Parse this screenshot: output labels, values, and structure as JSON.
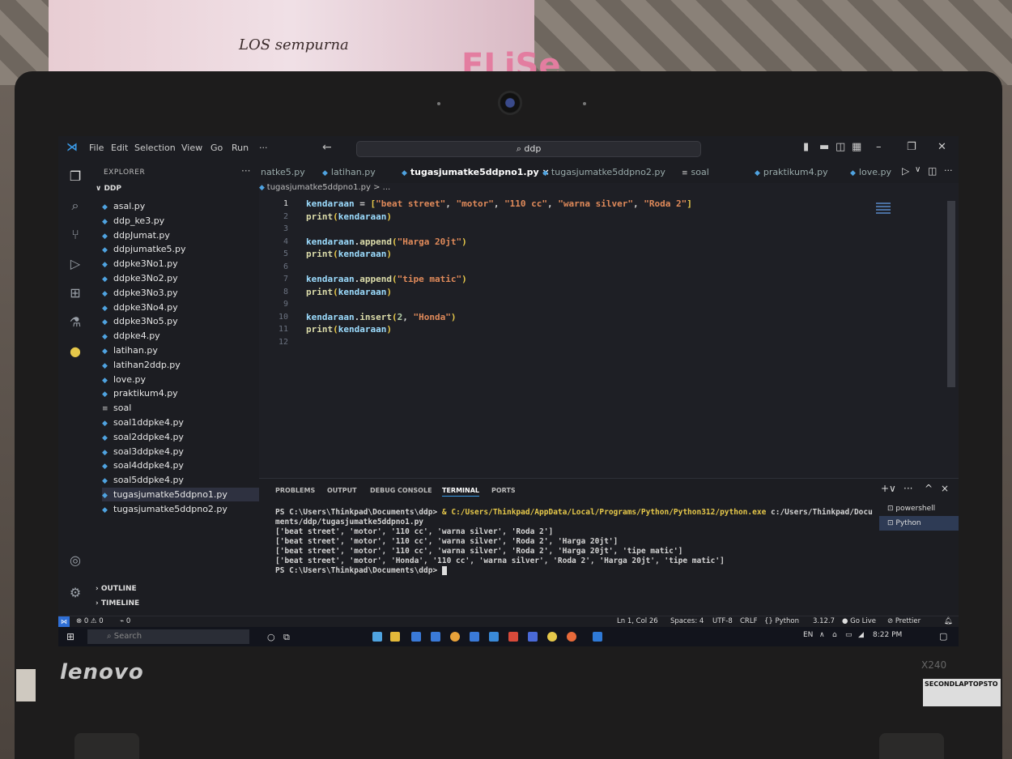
{
  "window": {
    "menu": [
      "File",
      "Edit",
      "Selection",
      "View",
      "Go",
      "Run",
      "···"
    ],
    "search_text": "ddp"
  },
  "explorer": {
    "title": "EXPLORER",
    "more": "···",
    "root": "DDP",
    "files": [
      {
        "name": "asal.py",
        "type": "py"
      },
      {
        "name": "ddp_ke3.py",
        "type": "py"
      },
      {
        "name": "ddpJumat.py",
        "type": "py"
      },
      {
        "name": "ddpjumatke5.py",
        "type": "py"
      },
      {
        "name": "ddpke3No1.py",
        "type": "py"
      },
      {
        "name": "ddpke3No2.py",
        "type": "py"
      },
      {
        "name": "ddpke3No3.py",
        "type": "py"
      },
      {
        "name": "ddpke3No4.py",
        "type": "py"
      },
      {
        "name": "ddpke3No5.py",
        "type": "py"
      },
      {
        "name": "ddpke4.py",
        "type": "py"
      },
      {
        "name": "latihan.py",
        "type": "py"
      },
      {
        "name": "latihan2ddp.py",
        "type": "py"
      },
      {
        "name": "love.py",
        "type": "py"
      },
      {
        "name": "praktikum4.py",
        "type": "py"
      },
      {
        "name": "soal",
        "type": "txt"
      },
      {
        "name": "soal1ddpke4.py",
        "type": "py"
      },
      {
        "name": "soal2ddpke4.py",
        "type": "py"
      },
      {
        "name": "soal3ddpke4.py",
        "type": "py"
      },
      {
        "name": "soal4ddpke4.py",
        "type": "py"
      },
      {
        "name": "soal5ddpke4.py",
        "type": "py"
      },
      {
        "name": "tugasjumatke5ddpno1.py",
        "type": "py",
        "selected": true
      },
      {
        "name": "tugasjumatke5ddpno2.py",
        "type": "py"
      }
    ],
    "outline": "OUTLINE",
    "timeline": "TIMELINE"
  },
  "tabs": [
    {
      "label": "natke5.py"
    },
    {
      "label": "latihan.py"
    },
    {
      "label": "tugasjumatke5ddpno1.py",
      "active": true,
      "close": "×"
    },
    {
      "label": "tugasjumatke5ddpno2.py"
    },
    {
      "label": "soal"
    },
    {
      "label": "praktikum4.py"
    },
    {
      "label": "love.py"
    }
  ],
  "breadcrumb": "tugasjumatke5ddpno1.py > ...",
  "editor": {
    "line_numbers": [
      "1",
      "2",
      "3",
      "4",
      "5",
      "6",
      "7",
      "8",
      "9",
      "10",
      "11",
      "12"
    ],
    "lines": [
      [
        {
          "t": "kendaraan",
          "c": "v"
        },
        {
          "t": " = ",
          "c": "o"
        },
        {
          "t": "[",
          "c": "p"
        },
        {
          "t": "\"beat street\"",
          "c": "s"
        },
        {
          "t": ", ",
          "c": "o"
        },
        {
          "t": "\"motor\"",
          "c": "s"
        },
        {
          "t": ", ",
          "c": "o"
        },
        {
          "t": "\"110 cc\"",
          "c": "s"
        },
        {
          "t": ", ",
          "c": "o"
        },
        {
          "t": "\"warna silver\"",
          "c": "s"
        },
        {
          "t": ", ",
          "c": "o"
        },
        {
          "t": "\"Roda 2\"",
          "c": "s"
        },
        {
          "t": "]",
          "c": "p"
        }
      ],
      [
        {
          "t": "print",
          "c": "f"
        },
        {
          "t": "(",
          "c": "p"
        },
        {
          "t": "kendaraan",
          "c": "v"
        },
        {
          "t": ")",
          "c": "p"
        }
      ],
      [],
      [
        {
          "t": "kendaraan",
          "c": "v"
        },
        {
          "t": ".",
          "c": "o"
        },
        {
          "t": "append",
          "c": "f"
        },
        {
          "t": "(",
          "c": "p"
        },
        {
          "t": "\"Harga 20jt\"",
          "c": "s"
        },
        {
          "t": ")",
          "c": "p"
        }
      ],
      [
        {
          "t": "print",
          "c": "f"
        },
        {
          "t": "(",
          "c": "p"
        },
        {
          "t": "kendaraan",
          "c": "v"
        },
        {
          "t": ")",
          "c": "p"
        }
      ],
      [],
      [
        {
          "t": "kendaraan",
          "c": "v"
        },
        {
          "t": ".",
          "c": "o"
        },
        {
          "t": "append",
          "c": "f"
        },
        {
          "t": "(",
          "c": "p"
        },
        {
          "t": "\"tipe matic\"",
          "c": "s"
        },
        {
          "t": ")",
          "c": "p"
        }
      ],
      [
        {
          "t": "print",
          "c": "f"
        },
        {
          "t": "(",
          "c": "p"
        },
        {
          "t": "kendaraan",
          "c": "v"
        },
        {
          "t": ")",
          "c": "p"
        }
      ],
      [],
      [
        {
          "t": "kendaraan",
          "c": "v"
        },
        {
          "t": ".",
          "c": "o"
        },
        {
          "t": "insert",
          "c": "f"
        },
        {
          "t": "(",
          "c": "p"
        },
        {
          "t": "2",
          "c": "n"
        },
        {
          "t": ", ",
          "c": "o"
        },
        {
          "t": "\"Honda\"",
          "c": "s"
        },
        {
          "t": ")",
          "c": "p"
        }
      ],
      [
        {
          "t": "print",
          "c": "f"
        },
        {
          "t": "(",
          "c": "p"
        },
        {
          "t": "kendaraan",
          "c": "v"
        },
        {
          "t": ")",
          "c": "p"
        }
      ],
      []
    ]
  },
  "panel": {
    "tabs": [
      "PROBLEMS",
      "OUTPUT",
      "DEBUG CONSOLE",
      "TERMINAL",
      "PORTS"
    ],
    "active_tab": "TERMINAL",
    "controls": [
      "+∨",
      "···",
      "^",
      "×"
    ],
    "terminal": {
      "cmd_prompt": "PS C:\\Users\\Thinkpad\\Documents\\ddp> ",
      "cmd_amp": "& ",
      "cmd_exe": "C:/Users/Thinkpad/AppData/Local/Programs/Python/Python312/python.exe",
      "cmd_arg": " c:/Users/Thinkpad/Docu",
      "cmd_wrap": "ments/ddp/tugasjumatke5ddpno1.py",
      "output": [
        "['beat street', 'motor', '110 cc', 'warna silver', 'Roda 2']",
        "['beat street', 'motor', '110 cc', 'warna silver', 'Roda 2', 'Harga 20jt']",
        "['beat street', 'motor', '110 cc', 'warna silver', 'Roda 2', 'Harga 20jt', 'tipe matic']",
        "['beat street', 'motor', 'Honda', '110 cc', 'warna silver', 'Roda 2', 'Harga 20jt', 'tipe matic']"
      ],
      "prompt": "PS C:\\Users\\Thinkpad\\Documents\\ddp> "
    },
    "terminal_list": [
      {
        "label": "powershell"
      },
      {
        "label": "Python",
        "selected": true
      }
    ]
  },
  "statusbar": {
    "problems": "⊗ 0 ⚠ 0",
    "ports": "⌁ 0",
    "position": "Ln 1, Col 26",
    "spaces": "Spaces: 4",
    "encoding": "UTF-8",
    "eol": "CRLF",
    "language": "{} Python",
    "version": "3.12.7",
    "golive": "Go Live",
    "prettier": "⊘ Prettier"
  },
  "taskbar": {
    "search_placeholder": "Search",
    "tray_lang": "EN",
    "clock": "8:22 PM"
  },
  "background": {
    "poster_text": "LOS sempurna",
    "poster_word": "ELiSe",
    "brand": "lenovo",
    "model": "X240",
    "sticker": "SECONDLAPTOPSTO"
  },
  "colors": {
    "accent": "#3a9ae8",
    "status_remote": "#2f6fd6"
  }
}
